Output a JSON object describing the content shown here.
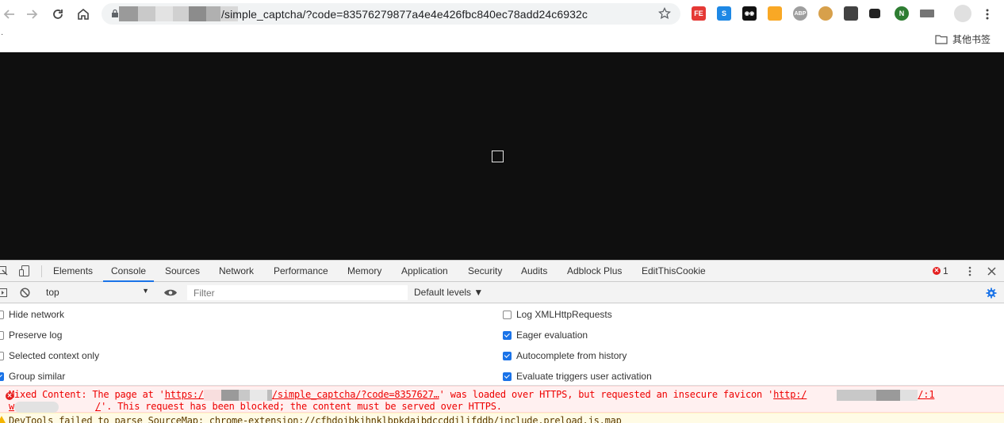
{
  "browser": {
    "url_path": "/simple_captcha/?code=83576279877a4e4e426fbc840ec78add24c6932c",
    "bookmarks_folder_label": "其他书签",
    "extensions": [
      {
        "name": "fe-helper-icon",
        "label": "FE",
        "color": "#e53935"
      },
      {
        "name": "s-extension-icon",
        "label": "S",
        "color": "#1e88e5"
      },
      {
        "name": "glasses-extension-icon",
        "label": "◉◉",
        "color": "#111111"
      },
      {
        "name": "notes-extension-icon",
        "label": "",
        "color": "#f9a825"
      },
      {
        "name": "adblock-plus-icon",
        "label": "ABP",
        "color": "#9e9e9e"
      },
      {
        "name": "cookie-icon",
        "label": "",
        "color": "#d7a04b"
      },
      {
        "name": "shield-extension-icon",
        "label": "",
        "color": "#424242"
      },
      {
        "name": "dark-extension-icon",
        "label": "",
        "color": "#212121"
      },
      {
        "name": "n-extension-icon",
        "label": "N",
        "color": "#2e7d32"
      },
      {
        "name": "crown-extension-icon",
        "label": "",
        "color": "#757575"
      },
      {
        "name": "soccer-extension-icon",
        "label": "",
        "color": "#616161"
      }
    ]
  },
  "devtools": {
    "tabs": [
      "Elements",
      "Console",
      "Sources",
      "Network",
      "Performance",
      "Memory",
      "Application",
      "Security",
      "Audits",
      "Adblock Plus",
      "EditThisCookie"
    ],
    "active_tab": "Console",
    "error_count": "1",
    "context": "top",
    "filter_placeholder": "Filter",
    "levels_label": "Default levels ▼",
    "settings_left": [
      {
        "label": "Hide network",
        "checked": false
      },
      {
        "label": "Preserve log",
        "checked": false
      },
      {
        "label": "Selected context only",
        "checked": false
      },
      {
        "label": "Group similar",
        "checked": true
      }
    ],
    "settings_right": [
      {
        "label": "Log XMLHttpRequests",
        "checked": false
      },
      {
        "label": "Eager evaluation",
        "checked": true
      },
      {
        "label": "Autocomplete from history",
        "checked": true
      },
      {
        "label": "Evaluate triggers user activation",
        "checked": true
      }
    ],
    "error_message": {
      "prefix": "Mixed Content: The page at '",
      "url1_start": "https:/",
      "url1_end": "/simple_captcha/?code=8357627…",
      "middle": "' was loaded over HTTPS, but requested an insecure favicon '",
      "url2_start": "http:/",
      "url2_end": "/:1",
      "line2_start": "w",
      "line2_url_end": "/",
      "line2_rest": "'. This request has been blocked; the content must be served over HTTPS."
    },
    "warning_message": "DevTools failed to parse SourceMap: chrome-extension://cfhdojbkjhnklbpkdaibdccddilifddb/include.preload.js.map"
  }
}
